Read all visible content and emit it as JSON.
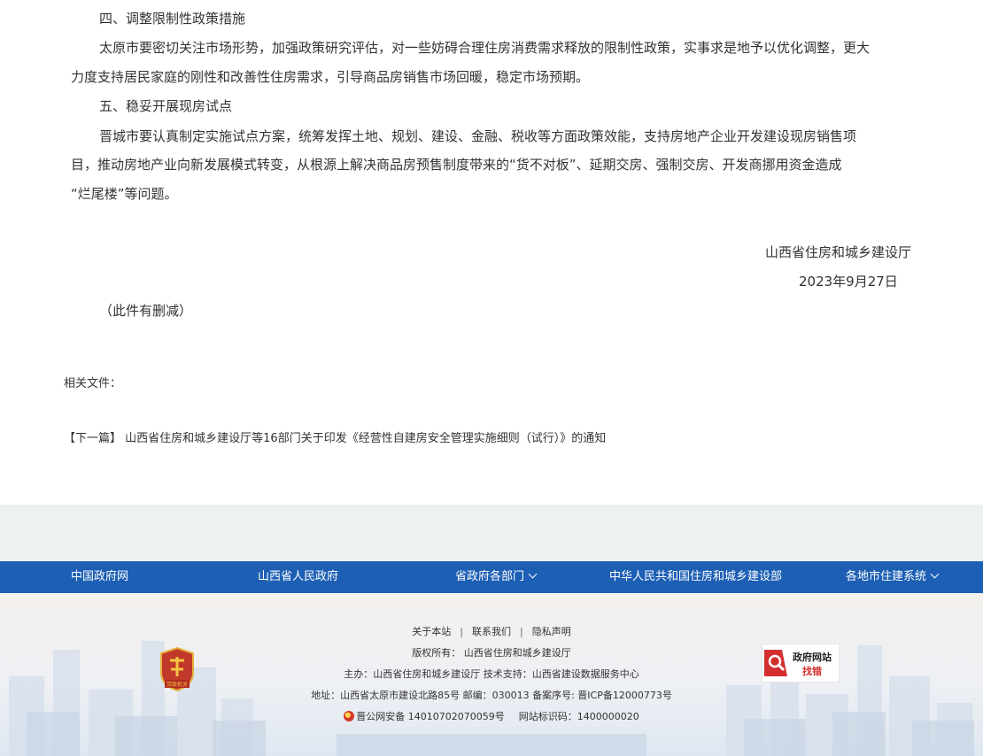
{
  "article": {
    "section4_title": "四、调整限制性政策措施",
    "section4_line1": "太原市要密切关注市场形势，加强政策研究评估，对一些妨碍合理住房消费需求释放的限制性政策，实事求是地予以优化调整，更大",
    "section4_line2": "力度支持居民家庭的刚性和改善性住房需求，引导商品房销售市场回暖，稳定市场预期。",
    "section5_title": "五、稳妥开展现房试点",
    "section5_line1": "晋城市要认真制定实施试点方案，统筹发挥土地、规划、建设、金融、税收等方面政策效能，支持房地产企业开发建设现房销售项",
    "section5_line2": "目，推动房地产业向新发展模式转变，从根源上解决商品房预售制度带来的“货不对板”、延期交房、强制交房、开发商挪用资金造成",
    "section5_line3": "“烂尾楼”等问题。",
    "issuer": "山西省住房和城乡建设厅",
    "date": "2023年9月27日",
    "note": "（此件有删减）"
  },
  "related_files_label": "相关文件：",
  "next_article": {
    "tag": "【下一篇】",
    "title": "山西省住房和城乡建设厅等16部门关于印发《经营性自建房安全管理实施细则（试行）》的通知"
  },
  "nav": {
    "items": [
      {
        "label": "中国政府网"
      },
      {
        "label": "山西省人民政府"
      },
      {
        "label": "省政府各部门"
      },
      {
        "label": "中华人民共和国住房和城乡建设部"
      },
      {
        "label": "各地市住建系统"
      }
    ]
  },
  "footer": {
    "about": "关于本站",
    "contact": "联系我们",
    "privacy": "隐私声明",
    "copyright": "版权所有：  山西省住房和城乡建设厅",
    "sponsor": "主办：山西省住房和城乡建设厅    技术支持：山西省建设数据服务中心",
    "address": "地址：山西省太原市建设北路85号    邮编：030013    备案序号: 晋ICP备12000773号",
    "police": "晋公网安备 14010702070059号",
    "site_id": "网站标识码：1400000020",
    "badge_left_text": "党政机关",
    "badge_right_text1": "政府网站",
    "badge_right_text2": "找错"
  },
  "colors": {
    "nav_bg": "#1d5fb4",
    "gray_band": "#eef1f2",
    "badge_red": "#c0392b"
  }
}
